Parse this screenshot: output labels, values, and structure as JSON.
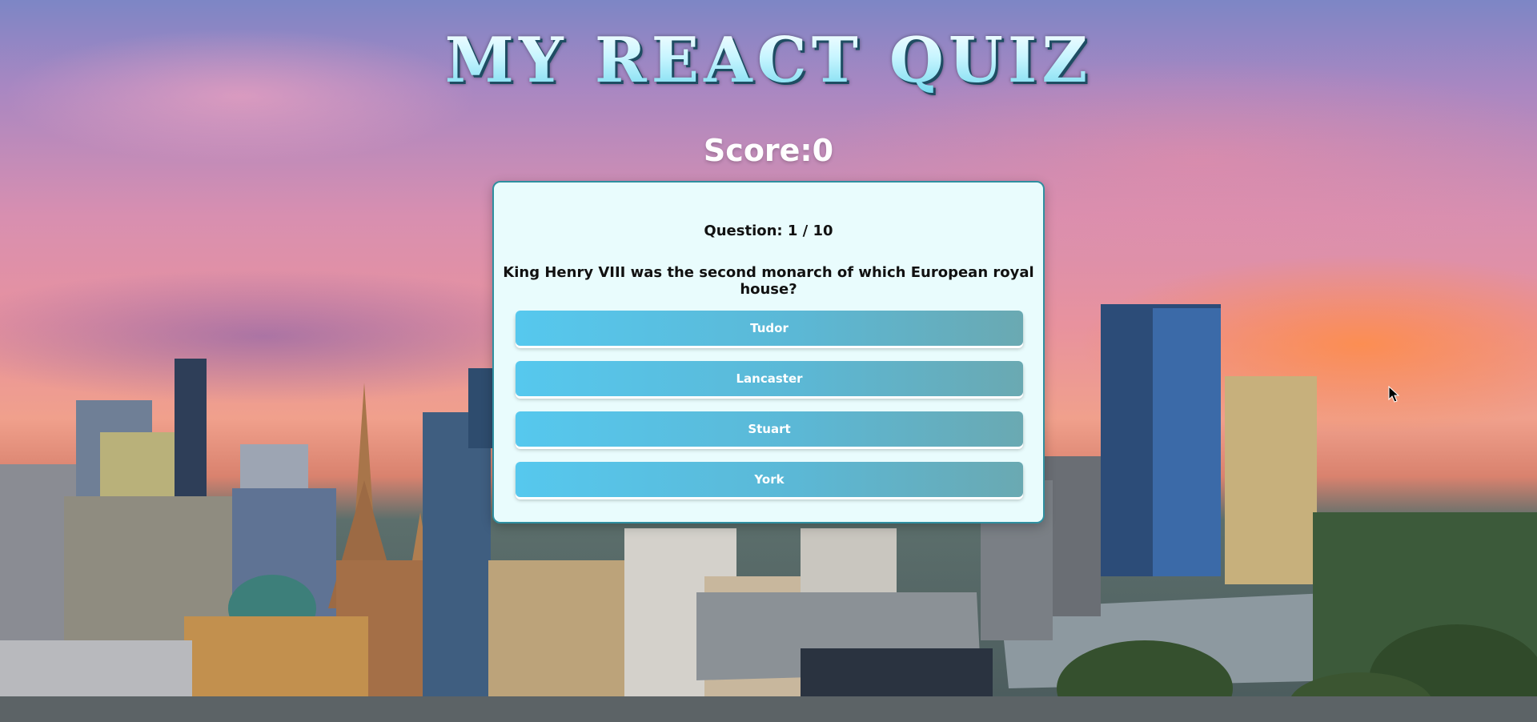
{
  "app": {
    "title": "My React Quiz"
  },
  "score": {
    "text": "Score:0"
  },
  "quiz": {
    "question_number": "Question: 1 / 10",
    "question_text": "King Henry VIII was the second monarch of which European royal house?",
    "answers": [
      "Tudor",
      "Lancaster",
      "Stuart",
      "York"
    ]
  },
  "colors": {
    "card_background": "#e9fcfd",
    "card_border": "#2f8fa0",
    "answer_gradient_start": "#56c8ee",
    "answer_gradient_end": "#6aa9b2",
    "title_fill": "#c8f5ff",
    "title_shadow": "#1e4d63"
  }
}
